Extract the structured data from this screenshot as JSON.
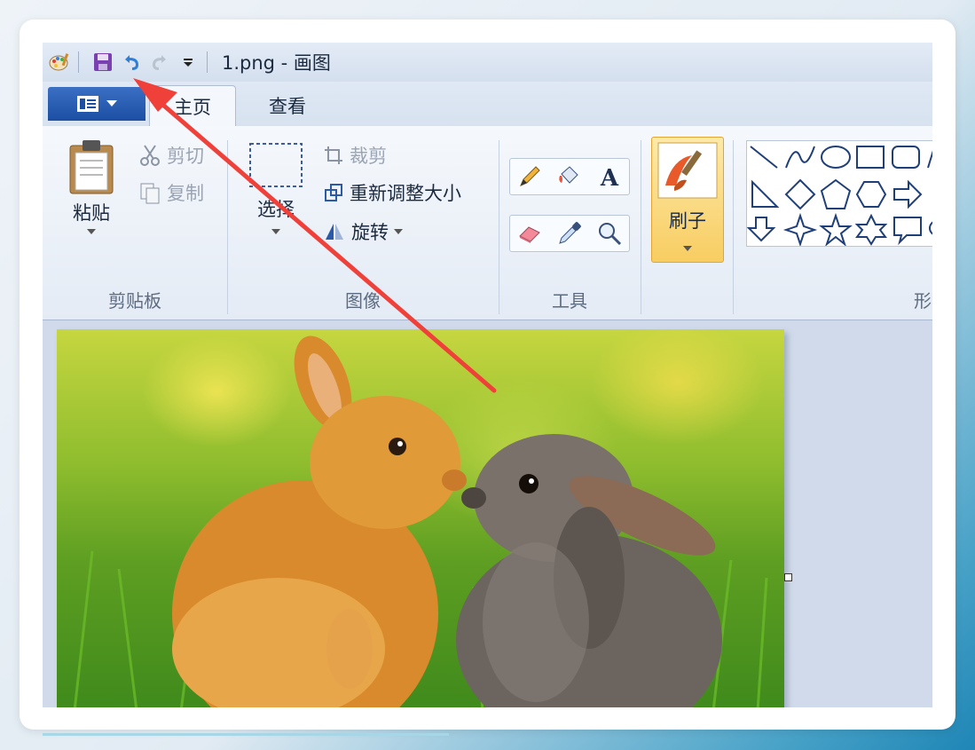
{
  "window": {
    "title": "1.png - 画图"
  },
  "quick_access": {
    "icons": [
      "paint-app-icon",
      "save-icon",
      "undo-icon",
      "redo-icon",
      "customize-dropdown-icon"
    ]
  },
  "tabs": [
    {
      "label": "主页",
      "active": true
    },
    {
      "label": "查看",
      "active": false
    }
  ],
  "ribbon": {
    "clipboard": {
      "paste": "粘贴",
      "cut": "剪切",
      "copy": "复制",
      "label": "剪贴板"
    },
    "image": {
      "select": "选择",
      "crop": "裁剪",
      "resize": "重新调整大小",
      "rotate": "旋转",
      "label": "图像"
    },
    "tools": {
      "label": "工具"
    },
    "brushes": {
      "label": "刷子"
    },
    "shapes": {
      "label": "形"
    }
  },
  "colors": {
    "accent_arrow": "#f0403a",
    "file_button": "#1c4fa3",
    "brush_highlight": "#f8cd62"
  }
}
